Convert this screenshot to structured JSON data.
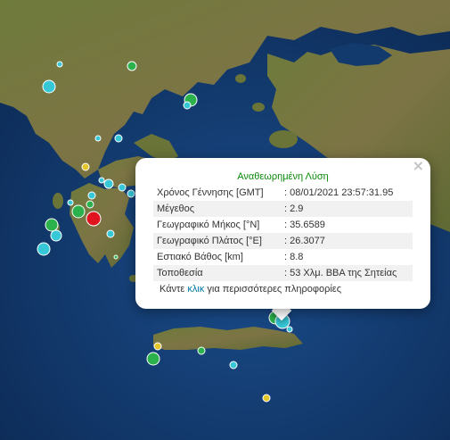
{
  "popup": {
    "title": "Αναθεωρημένη Λύση",
    "rows": [
      {
        "label": "Χρόνος Γέννησης [GMT]",
        "value": ": 08/01/2021 23:57:31.95"
      },
      {
        "label": "Μέγεθος",
        "value": ": 2.9"
      },
      {
        "label": "Γεωγραφικό Μήκος [°N]",
        "value": ": 35.6589"
      },
      {
        "label": "Γεωγραφικό Πλάτος [°E]",
        "value": ": 26.3077"
      },
      {
        "label": "Εστιακό Βάθος [km]",
        "value": ": 8.8"
      },
      {
        "label": "Τοποθεσία",
        "value": ": 53 Χλμ. ΒΒΑ της Σητείας"
      }
    ],
    "more_prefix": "Κάντε",
    "more_link": "κλικ",
    "more_suffix": "για περισσότερες πληροφορίες",
    "close_glyph": "×"
  },
  "map": {
    "colors": {
      "sea": "#0e2f5c",
      "land": "#6f7a3a",
      "highland": "#8a7a55",
      "marker_cyan": "#37c8d8",
      "marker_green": "#2bb24c",
      "marker_yellow": "#e2c62a",
      "marker_red": "#e0141e"
    },
    "markers": [
      {
        "icon": "cyan-quake-marker",
        "color": "cyan"
      },
      {
        "icon": "green-quake-marker",
        "color": "green"
      },
      {
        "icon": "yellow-quake-marker",
        "color": "yellow"
      },
      {
        "icon": "red-quake-marker",
        "color": "red"
      }
    ]
  }
}
